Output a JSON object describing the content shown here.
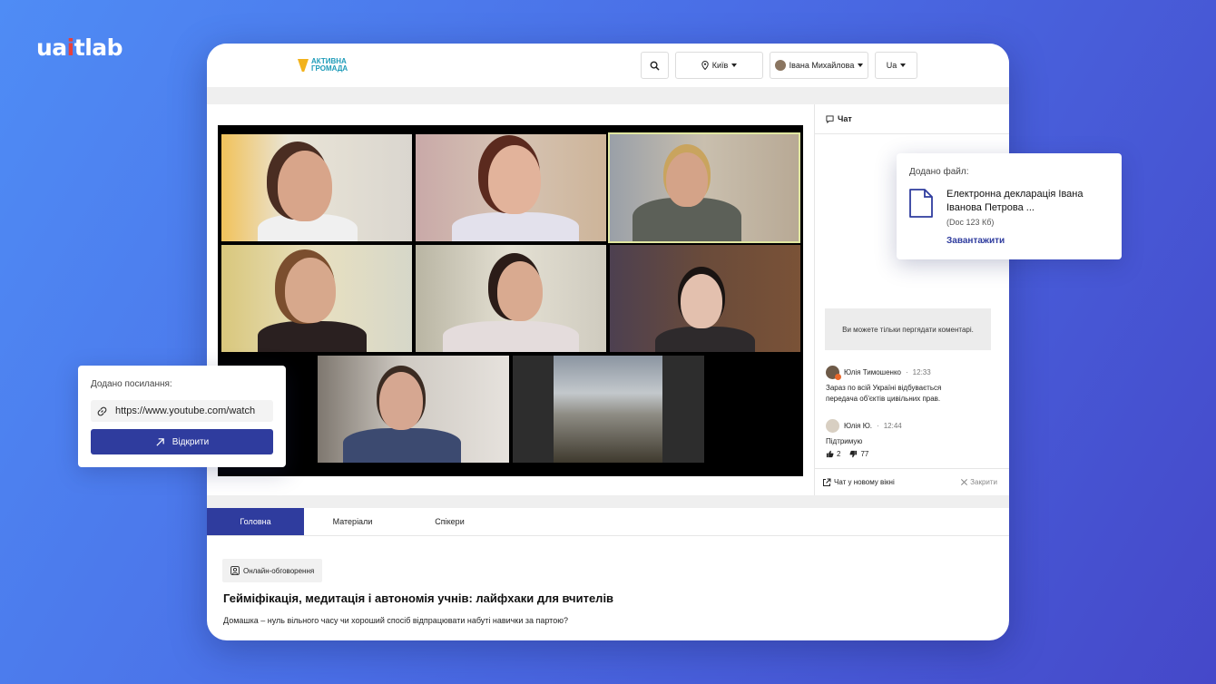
{
  "brand": {
    "name_left": "ua",
    "name_bar": "i",
    "name_right": "tlab"
  },
  "header": {
    "logo_line1": "АКТИВНА",
    "logo_line2": "ГРОМАДА",
    "city": "Київ",
    "user": "Івана Михайлова",
    "lang": "Ua"
  },
  "chat": {
    "title": "Чат",
    "notice": "Ви можете тільки пергядати коментарі.",
    "messages": [
      {
        "author": "Юлія Тимошенко",
        "time": "12:33",
        "text_line1": "Зараз по всій Україні відбувається",
        "text_line2": "передача об'єктів цивільних прав."
      },
      {
        "author": "Юлія Ю.",
        "time": "12:44",
        "text_line1": "Підтримую",
        "text_line2": ""
      }
    ],
    "likes": "2",
    "dislikes": "77",
    "open_new_window": "Чат у новому вікні",
    "close": "Закрити"
  },
  "tabs": [
    "Головна",
    "Матеріали",
    "Спікери"
  ],
  "event": {
    "chip": "Онлайн-обговорення",
    "title": "Гейміфікація, медитація і автономія учнів: лайфхаки для вчителів",
    "subtitle": "Домашка – нуль вільного часу чи хороший спосіб відпрацювати набуті навички за партою?"
  },
  "file_card": {
    "label": "Додано файл:",
    "file_name": "Електронна декларація Івана Іванова Петрова ...",
    "file_size": "(Doc 123 Кб)",
    "download": "Завантажити"
  },
  "link_card": {
    "label": "Додано посилання:",
    "url": "https://www.youtube.com/watch",
    "open": "Відкрити"
  },
  "colors": {
    "accent": "#2f3c9e",
    "brand_bar": "#e8403a",
    "logo_yellow": "#f2b21c",
    "logo_teal": "#1d9bb8"
  }
}
